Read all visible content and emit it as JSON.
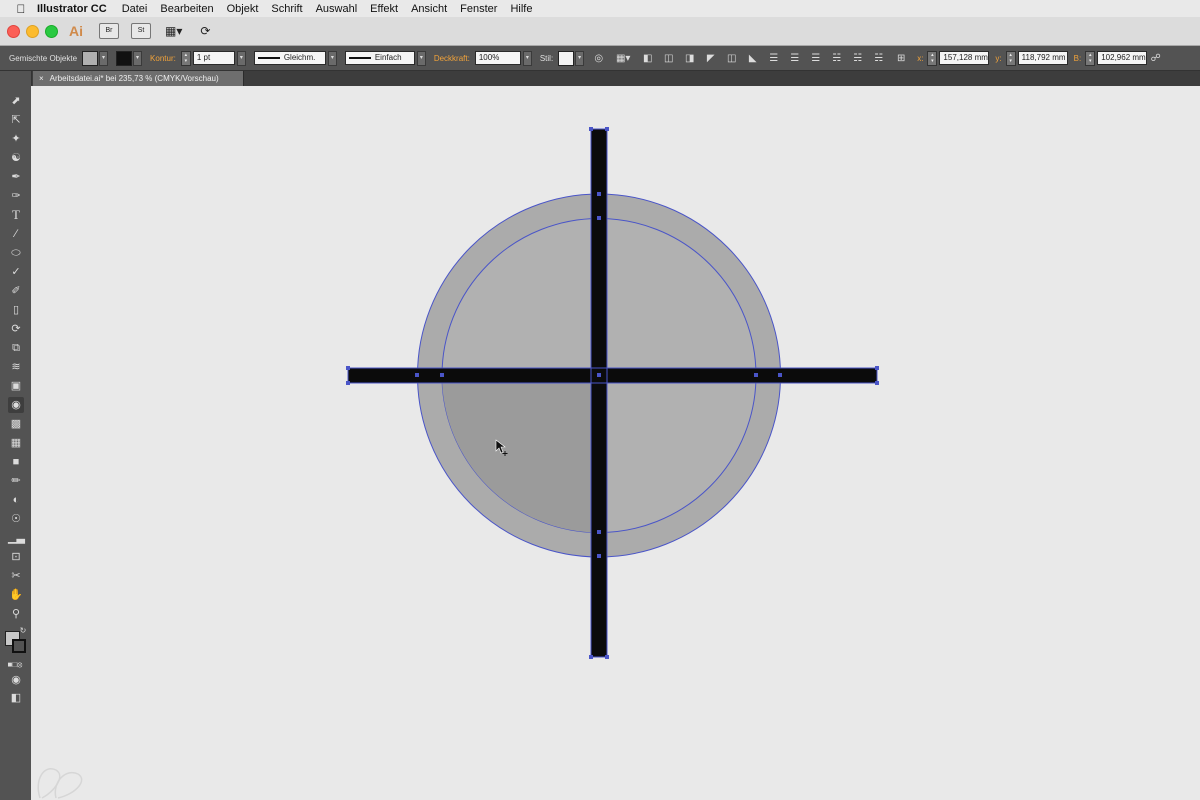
{
  "menubar": {
    "apple_icon": "apple-icon",
    "app_name": "Illustrator CC",
    "items": [
      "Datei",
      "Bearbeiten",
      "Objekt",
      "Schrift",
      "Auswahl",
      "Effekt",
      "Ansicht",
      "Fenster",
      "Hilfe"
    ]
  },
  "appbar": {
    "logo": "Ai",
    "bridge_label": "Br",
    "stock_label": "St"
  },
  "controlbar": {
    "selection_label": "Gemischte Objekte",
    "stroke_label": "Kontur:",
    "stroke_weight": "1 pt",
    "profile_value": "Gleichm.",
    "brush_value": "Einfach",
    "opacity_label": "Deckkraft:",
    "opacity_value": "100%",
    "style_label": "Stil:",
    "x_label": "x:",
    "x_value": "157,128 mm",
    "y_label": "y:",
    "y_value": "118,792 mm",
    "b_label": "B:",
    "b_value": "102,962 mm"
  },
  "document": {
    "close_glyph": "×",
    "tab_title": "Arbeitsdatei.ai* bei 235,73 % (CMYK/Vorschau)"
  },
  "tools": [
    "selection-tool-icon",
    "direct-selection-tool-icon",
    "magic-wand-tool-icon",
    "lasso-tool-icon",
    "pen-tool-icon",
    "curvature-tool-icon",
    "type-tool-icon",
    "line-segment-tool-icon",
    "ellipse-tool-icon",
    "paintbrush-tool-icon",
    "shaper-tool-icon",
    "eraser-tool-icon",
    "rotate-tool-icon",
    "scale-tool-icon",
    "warp-tool-icon",
    "free-transform-tool-icon",
    "shape-builder-tool-icon",
    "perspective-grid-tool-icon",
    "mesh-tool-icon",
    "gradient-tool-icon",
    "eyedropper-tool-icon",
    "blend-tool-icon",
    "symbol-sprayer-tool-icon",
    "column-graph-tool-icon",
    "artboard-tool-icon",
    "slice-tool-icon",
    "hand-tool-icon",
    "zoom-tool-icon"
  ],
  "colors": {
    "accent": "#f2a33a",
    "selection": "#4a55c8",
    "fill_outer": "#ababab",
    "fill_inner": "#b1b1b1",
    "fill_active": "#9b9b9b",
    "crosshair": "#0b0b0b"
  }
}
